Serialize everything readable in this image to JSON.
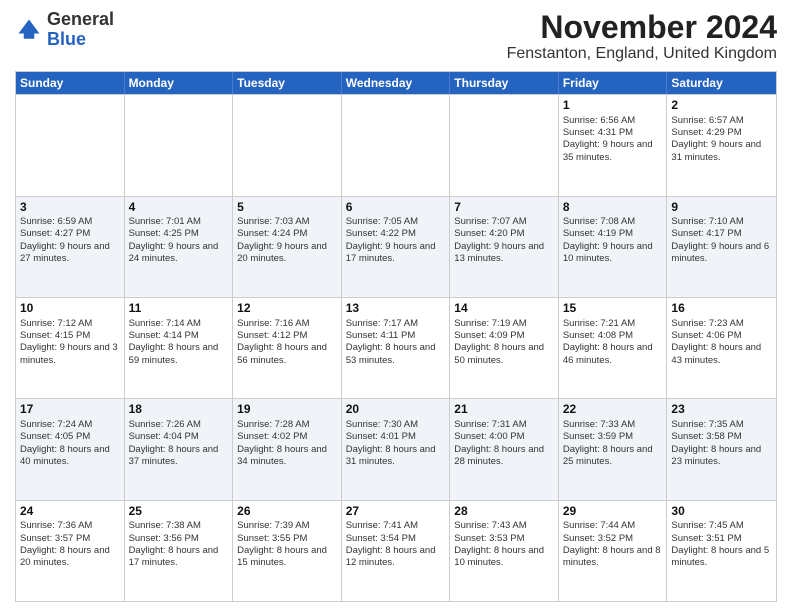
{
  "header": {
    "logo_general": "General",
    "logo_blue": "Blue",
    "title": "November 2024",
    "subtitle": "Fenstanton, England, United Kingdom"
  },
  "days": [
    "Sunday",
    "Monday",
    "Tuesday",
    "Wednesday",
    "Thursday",
    "Friday",
    "Saturday"
  ],
  "rows": [
    {
      "alt": false,
      "cells": [
        {
          "num": "",
          "text": ""
        },
        {
          "num": "",
          "text": ""
        },
        {
          "num": "",
          "text": ""
        },
        {
          "num": "",
          "text": ""
        },
        {
          "num": "",
          "text": ""
        },
        {
          "num": "1",
          "text": "Sunrise: 6:56 AM\nSunset: 4:31 PM\nDaylight: 9 hours and 35 minutes."
        },
        {
          "num": "2",
          "text": "Sunrise: 6:57 AM\nSunset: 4:29 PM\nDaylight: 9 hours and 31 minutes."
        }
      ]
    },
    {
      "alt": true,
      "cells": [
        {
          "num": "3",
          "text": "Sunrise: 6:59 AM\nSunset: 4:27 PM\nDaylight: 9 hours and 27 minutes."
        },
        {
          "num": "4",
          "text": "Sunrise: 7:01 AM\nSunset: 4:25 PM\nDaylight: 9 hours and 24 minutes."
        },
        {
          "num": "5",
          "text": "Sunrise: 7:03 AM\nSunset: 4:24 PM\nDaylight: 9 hours and 20 minutes."
        },
        {
          "num": "6",
          "text": "Sunrise: 7:05 AM\nSunset: 4:22 PM\nDaylight: 9 hours and 17 minutes."
        },
        {
          "num": "7",
          "text": "Sunrise: 7:07 AM\nSunset: 4:20 PM\nDaylight: 9 hours and 13 minutes."
        },
        {
          "num": "8",
          "text": "Sunrise: 7:08 AM\nSunset: 4:19 PM\nDaylight: 9 hours and 10 minutes."
        },
        {
          "num": "9",
          "text": "Sunrise: 7:10 AM\nSunset: 4:17 PM\nDaylight: 9 hours and 6 minutes."
        }
      ]
    },
    {
      "alt": false,
      "cells": [
        {
          "num": "10",
          "text": "Sunrise: 7:12 AM\nSunset: 4:15 PM\nDaylight: 9 hours and 3 minutes."
        },
        {
          "num": "11",
          "text": "Sunrise: 7:14 AM\nSunset: 4:14 PM\nDaylight: 8 hours and 59 minutes."
        },
        {
          "num": "12",
          "text": "Sunrise: 7:16 AM\nSunset: 4:12 PM\nDaylight: 8 hours and 56 minutes."
        },
        {
          "num": "13",
          "text": "Sunrise: 7:17 AM\nSunset: 4:11 PM\nDaylight: 8 hours and 53 minutes."
        },
        {
          "num": "14",
          "text": "Sunrise: 7:19 AM\nSunset: 4:09 PM\nDaylight: 8 hours and 50 minutes."
        },
        {
          "num": "15",
          "text": "Sunrise: 7:21 AM\nSunset: 4:08 PM\nDaylight: 8 hours and 46 minutes."
        },
        {
          "num": "16",
          "text": "Sunrise: 7:23 AM\nSunset: 4:06 PM\nDaylight: 8 hours and 43 minutes."
        }
      ]
    },
    {
      "alt": true,
      "cells": [
        {
          "num": "17",
          "text": "Sunrise: 7:24 AM\nSunset: 4:05 PM\nDaylight: 8 hours and 40 minutes."
        },
        {
          "num": "18",
          "text": "Sunrise: 7:26 AM\nSunset: 4:04 PM\nDaylight: 8 hours and 37 minutes."
        },
        {
          "num": "19",
          "text": "Sunrise: 7:28 AM\nSunset: 4:02 PM\nDaylight: 8 hours and 34 minutes."
        },
        {
          "num": "20",
          "text": "Sunrise: 7:30 AM\nSunset: 4:01 PM\nDaylight: 8 hours and 31 minutes."
        },
        {
          "num": "21",
          "text": "Sunrise: 7:31 AM\nSunset: 4:00 PM\nDaylight: 8 hours and 28 minutes."
        },
        {
          "num": "22",
          "text": "Sunrise: 7:33 AM\nSunset: 3:59 PM\nDaylight: 8 hours and 25 minutes."
        },
        {
          "num": "23",
          "text": "Sunrise: 7:35 AM\nSunset: 3:58 PM\nDaylight: 8 hours and 23 minutes."
        }
      ]
    },
    {
      "alt": false,
      "cells": [
        {
          "num": "24",
          "text": "Sunrise: 7:36 AM\nSunset: 3:57 PM\nDaylight: 8 hours and 20 minutes."
        },
        {
          "num": "25",
          "text": "Sunrise: 7:38 AM\nSunset: 3:56 PM\nDaylight: 8 hours and 17 minutes."
        },
        {
          "num": "26",
          "text": "Sunrise: 7:39 AM\nSunset: 3:55 PM\nDaylight: 8 hours and 15 minutes."
        },
        {
          "num": "27",
          "text": "Sunrise: 7:41 AM\nSunset: 3:54 PM\nDaylight: 8 hours and 12 minutes."
        },
        {
          "num": "28",
          "text": "Sunrise: 7:43 AM\nSunset: 3:53 PM\nDaylight: 8 hours and 10 minutes."
        },
        {
          "num": "29",
          "text": "Sunrise: 7:44 AM\nSunset: 3:52 PM\nDaylight: 8 hours and 8 minutes."
        },
        {
          "num": "30",
          "text": "Sunrise: 7:45 AM\nSunset: 3:51 PM\nDaylight: 8 hours and 5 minutes."
        }
      ]
    }
  ]
}
